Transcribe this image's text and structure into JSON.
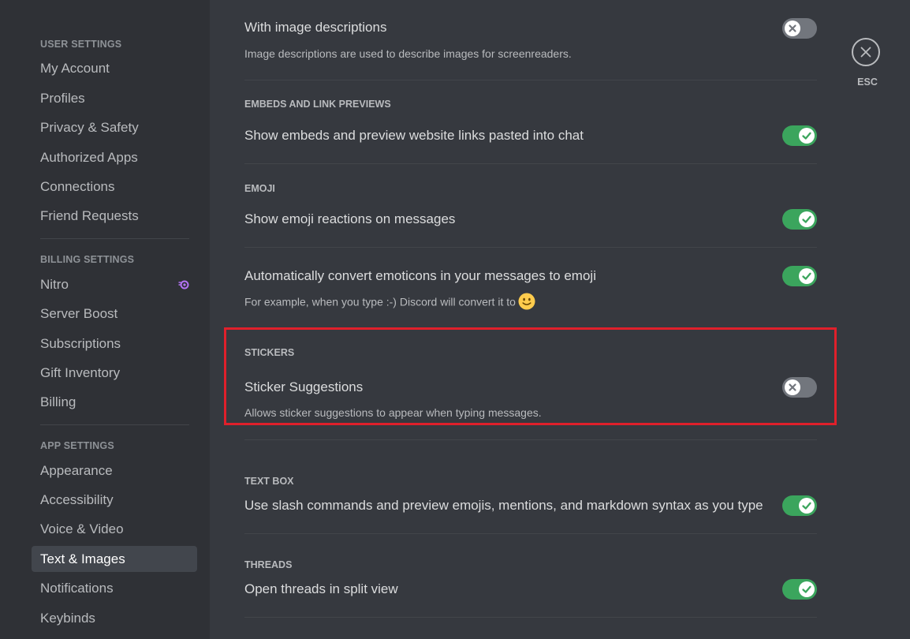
{
  "sidebar": {
    "sections": [
      {
        "header": "USER SETTINGS",
        "items": [
          "My Account",
          "Profiles",
          "Privacy & Safety",
          "Authorized Apps",
          "Connections",
          "Friend Requests"
        ]
      },
      {
        "header": "BILLING SETTINGS",
        "items": [
          "Nitro",
          "Server Boost",
          "Subscriptions",
          "Gift Inventory",
          "Billing"
        ]
      },
      {
        "header": "APP SETTINGS",
        "items": [
          "Appearance",
          "Accessibility",
          "Voice & Video",
          "Text & Images",
          "Notifications",
          "Keybinds"
        ]
      }
    ],
    "selected": "Text & Images"
  },
  "settings": {
    "image_descriptions": {
      "title": "With image descriptions",
      "note": "Image descriptions are used to describe images for screenreaders.",
      "enabled": false
    },
    "embeds": {
      "header": "EMBEDS AND LINK PREVIEWS",
      "title": "Show embeds and preview website links pasted into chat",
      "enabled": true
    },
    "emoji": {
      "header": "EMOJI",
      "reactions_title": "Show emoji reactions on messages",
      "reactions_enabled": true,
      "convert_title": "Automatically convert emoticons in your messages to emoji",
      "convert_note": "For example, when you type :-) Discord will convert it to",
      "convert_enabled": true
    },
    "stickers": {
      "header": "STICKERS",
      "title": "Sticker Suggestions",
      "note": "Allows sticker suggestions to appear when typing messages.",
      "enabled": false
    },
    "text_box": {
      "header": "TEXT BOX",
      "title": "Use slash commands and preview emojis, mentions, and markdown syntax as you type",
      "enabled": true
    },
    "threads": {
      "header": "THREADS",
      "title": "Open threads in split view",
      "enabled": true
    }
  },
  "close": {
    "label": "ESC"
  },
  "colors": {
    "toggle_on": "#3ba55d",
    "toggle_off": "#72767d",
    "highlight": "#e0202b",
    "nitro": "#b473f5"
  },
  "icons": {
    "close": "close-icon",
    "check": "check-icon",
    "cross": "x-icon",
    "nitro": "nitro-icon",
    "emoji": "slightly-smiling-face-emoji"
  }
}
